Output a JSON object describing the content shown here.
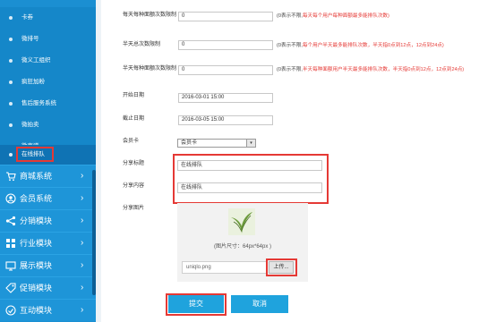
{
  "sidebar": {
    "sub_items": [
      {
        "label": "卡券"
      },
      {
        "label": "微排号"
      },
      {
        "label": "微义工组织"
      },
      {
        "label": "疯狂加粉"
      },
      {
        "label": "售后服务系统"
      },
      {
        "label": "微拍卖"
      },
      {
        "label": "微商谱"
      },
      {
        "label": "在线排队"
      }
    ],
    "active_sub_item": "在线排队",
    "nav_items": [
      {
        "label": "商城系统",
        "icon": "cart-icon"
      },
      {
        "label": "会员系统",
        "icon": "user-icon"
      },
      {
        "label": "分销模块",
        "icon": "share-icon"
      },
      {
        "label": "行业模块",
        "icon": "grid-icon"
      },
      {
        "label": "展示模块",
        "icon": "display-icon"
      },
      {
        "label": "促销模块",
        "icon": "promo-icon"
      },
      {
        "label": "互动模块",
        "icon": "interact-icon"
      }
    ],
    "arrow": "›"
  },
  "form": {
    "daily_limit": {
      "label": "每天每种面额次数限制",
      "value": "0",
      "hint_gray": "(0表示不限,",
      "hint_red": "每天每个用户每种面额最多能排队次数)"
    },
    "halfday_total": {
      "label": "半天总次数限制",
      "value": "0",
      "hint_gray": "(0表示不限,",
      "hint_red": "每个用户半天最多能排队次数，半天指0点到12点，12点到24点)"
    },
    "halfday_each": {
      "label": "半天每种面额次数限制",
      "value": "0",
      "hint_gray": "(0表示不限,",
      "hint_red": "半天每种面额用户半天最多能排队次数，半天指0点到12点，12点到24点)"
    },
    "start_date": {
      "label": "开始日期",
      "value": "2016-03-01 15:00"
    },
    "end_date": {
      "label": "截止日期",
      "value": "2016-03-05 15:00"
    },
    "member_card": {
      "label": "会员卡",
      "value": "会员卡",
      "dropdown_glyph": "▾"
    },
    "share_title": {
      "label": "分享标题",
      "value": "在线排队"
    },
    "share_content": {
      "label": "分享内容",
      "value": "在线排队"
    },
    "share_image": {
      "label": "分享图片",
      "size_note": "(图片尺寸：64px*64px )",
      "file_name": "uniqlo.png",
      "upload_label": "上传..."
    }
  },
  "actions": {
    "submit": "提交",
    "cancel": "取消"
  },
  "colors": {
    "sidebar": "#1b8fd2",
    "accent_button": "#1fa3dd",
    "highlight": "#e53935",
    "hint_red": "#e53935"
  }
}
